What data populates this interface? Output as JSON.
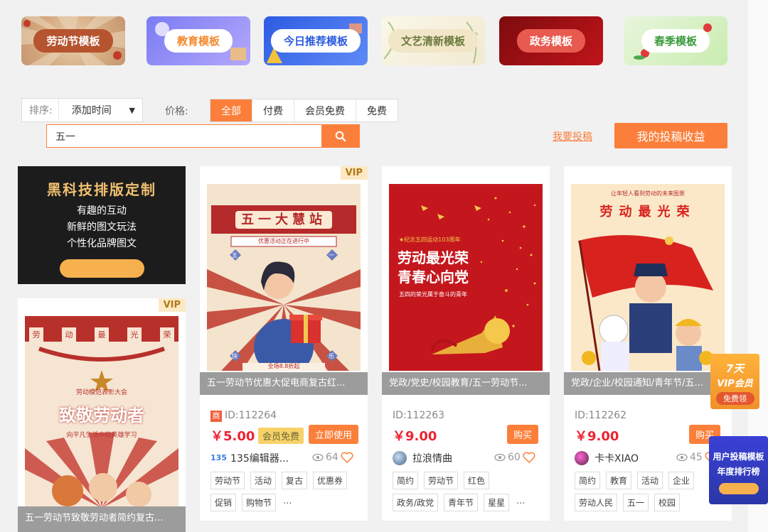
{
  "categories": [
    {
      "label": "劳动节模板",
      "bg": "#d9b896",
      "pill_bg": "#b5542f",
      "pill_fg": "#ffffff"
    },
    {
      "label": "教育模板",
      "bg": "#8e8ef5",
      "pill_bg": "#ffffff",
      "pill_fg": "#f18a2e"
    },
    {
      "label": "今日推荐模板",
      "bg": "#3f6fe8",
      "pill_bg": "#ffffff",
      "pill_fg": "#2c5ae0"
    },
    {
      "label": "文艺清新模板",
      "bg": "#f7f1dc",
      "pill_bg": "#f2e6c8",
      "pill_fg": "#6b7a3e"
    },
    {
      "label": "政务模板",
      "bg": "#a10e12",
      "pill_bg": "#e85a4f",
      "pill_fg": "#ffffff"
    },
    {
      "label": "春季模板",
      "bg": "#d9f1c6",
      "pill_bg": "#ffffff",
      "pill_fg": "#3a9a3a"
    }
  ],
  "filters": {
    "sort_label": "排序:",
    "sort_value": "添加时间",
    "price_label": "价格:",
    "price_options": [
      "全部",
      "付费",
      "会员免费",
      "免费"
    ]
  },
  "search": {
    "value": "五一"
  },
  "actions": {
    "submit_link": "我要投稿",
    "earnings_button": "我的投稿收益"
  },
  "promo": {
    "title": "黑科技排版定制",
    "line1": "有趣的互动",
    "line2": "新鲜的图文玩法",
    "line3": "个性化品牌图文"
  },
  "left_card": {
    "vip": "VIP",
    "caption": "五一劳动节致敬劳动者简约复古...",
    "poster_top_chars": [
      "劳",
      "动",
      "最",
      "光",
      "荣"
    ],
    "poster_sub": "劳动模范表彰大会",
    "poster_title": "致敬劳动者",
    "poster_tagline": "向平凡生活中的英雄学习"
  },
  "cards": [
    {
      "vip": "VIP",
      "caption": "五一劳动节优惠大促电商复古红...",
      "id": "ID:112264",
      "price": "￥5.00",
      "member_tag": "会员免费",
      "action": "立即使用",
      "author": "135编辑器...",
      "views": "64",
      "tags": [
        "劳动节",
        "活动",
        "复古",
        "优惠券",
        "促销",
        "购物节"
      ],
      "more": "...",
      "poster_title": "五一大慧站",
      "poster_sub": "优惠活动正在进行中",
      "poster_corners": [
        "五",
        "一",
        "快",
        "乐"
      ],
      "poster_bottom": "全场8.8折起"
    },
    {
      "vip": "",
      "caption": "党政/党史/校园教育/五一劳动节...",
      "id": "ID:112263",
      "price": "￥9.00",
      "action": "购买",
      "author": "拉浪情曲",
      "views": "60",
      "tags": [
        "简约",
        "劳动节",
        "红色",
        "政务/政党",
        "青年节",
        "星星"
      ],
      "more": "...",
      "poster_small": "★纪念五四运动103周年",
      "poster_title1": "劳动最光荣",
      "poster_title2": "青春心向党",
      "poster_sub": "五四的荣光属于奋斗的青年"
    },
    {
      "vip": "",
      "caption": "党政/企业/校园通知/青年节/五...",
      "id": "ID:112262",
      "price": "￥9.00",
      "action": "购买",
      "author": "卡卡XIAO",
      "views": "45",
      "tags": [
        "简约",
        "教育",
        "活动",
        "企业",
        "劳动人民",
        "五一",
        "校园"
      ],
      "more": "",
      "poster_small": "让年轻人看到劳动的未来图景",
      "poster_title": "劳动最光荣"
    }
  ],
  "float_vip": {
    "line1": "7天",
    "line2": "VIP会员",
    "line3": "免费领"
  },
  "float_rank": {
    "line1": "用户投稿模板",
    "line2": "年度排行榜"
  }
}
